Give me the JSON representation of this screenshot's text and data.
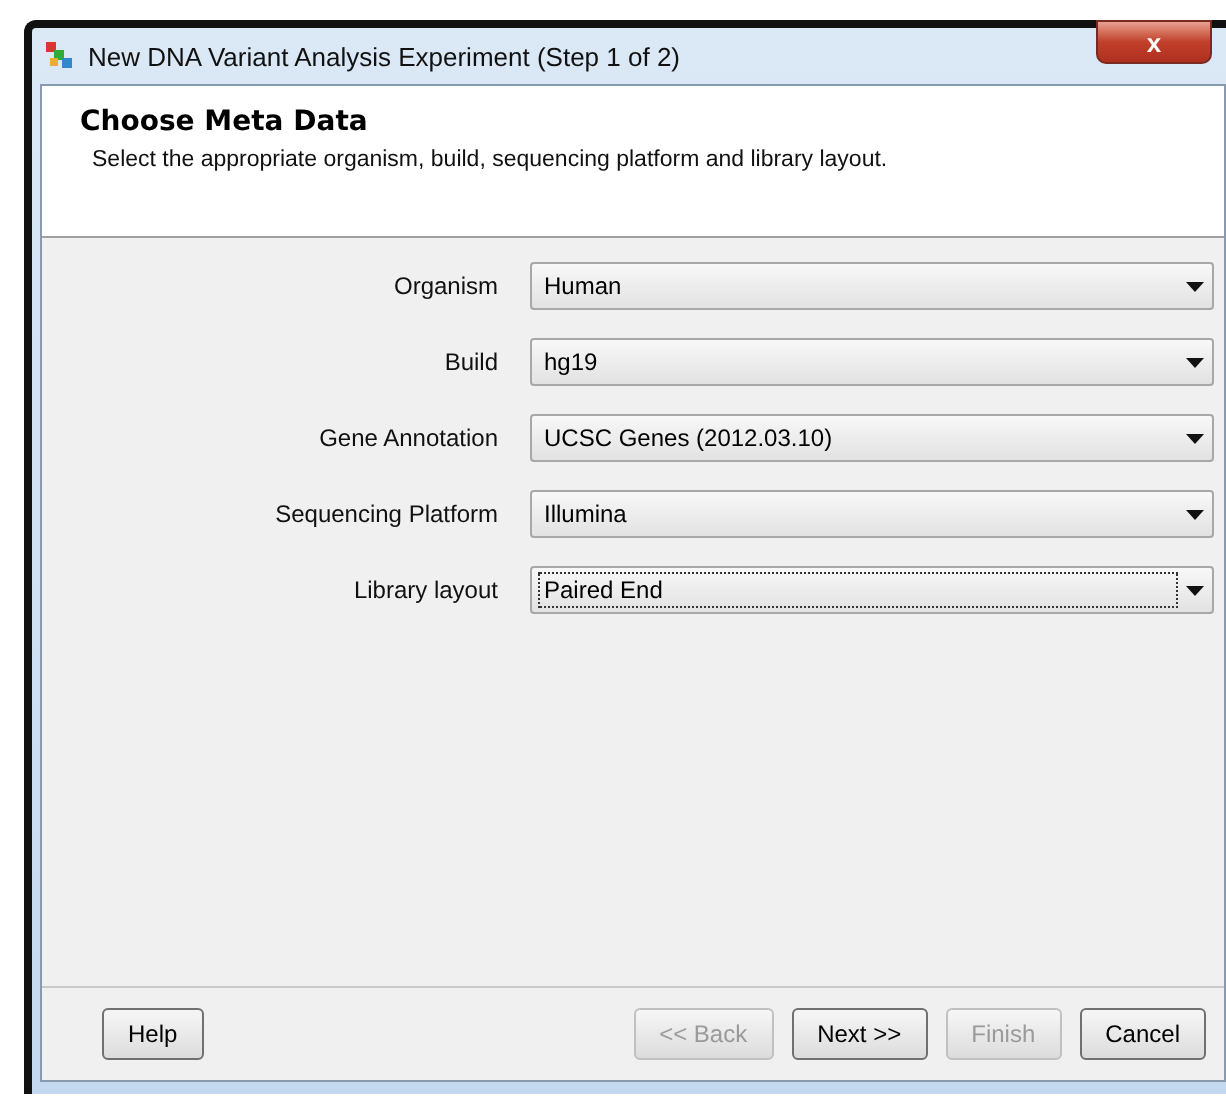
{
  "window": {
    "title": "New DNA Variant Analysis Experiment (Step 1 of 2)",
    "close": "x"
  },
  "header": {
    "title": "Choose Meta Data",
    "description": "Select the appropriate organism, build, sequencing platform and library layout."
  },
  "fields": [
    {
      "label": "Organism",
      "value": "Human",
      "focused": false
    },
    {
      "label": "Build",
      "value": "hg19",
      "focused": false
    },
    {
      "label": "Gene Annotation",
      "value": "UCSC Genes (2012.03.10)",
      "focused": false
    },
    {
      "label": "Sequencing Platform",
      "value": "Illumina",
      "focused": false
    },
    {
      "label": "Library layout",
      "value": "Paired End",
      "focused": true
    }
  ],
  "buttons": [
    {
      "label": "Help",
      "disabled": false,
      "kind": "left"
    },
    {
      "label": "<< Back",
      "disabled": true,
      "kind": "right"
    },
    {
      "label": "Next >>",
      "disabled": false,
      "kind": "right"
    },
    {
      "label": "Finish",
      "disabled": true,
      "kind": "right"
    },
    {
      "label": "Cancel",
      "disabled": false,
      "kind": "right"
    }
  ]
}
